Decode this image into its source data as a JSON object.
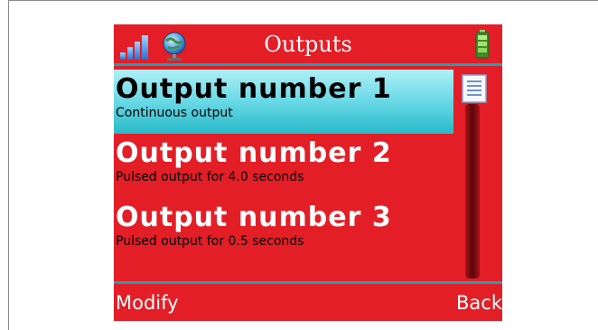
{
  "header": {
    "title": "Outputs",
    "icons": [
      "signal-strength-icon",
      "globe-icon",
      "battery-icon"
    ]
  },
  "outputs": [
    {
      "name": "Output number 1",
      "description": "Continuous output",
      "selected": true
    },
    {
      "name": "Output number 2",
      "description": "Pulsed output for 4.0 seconds",
      "selected": false
    },
    {
      "name": "Output number 3",
      "description": "Pulsed output for 0.5 seconds",
      "selected": false
    }
  ],
  "softkeys": {
    "left": "Modify",
    "right": "Back"
  },
  "colors": {
    "background": "#e31e27",
    "accent": "#1aa3b5",
    "selection": "#6fdbe8",
    "text": "#ffffff"
  }
}
